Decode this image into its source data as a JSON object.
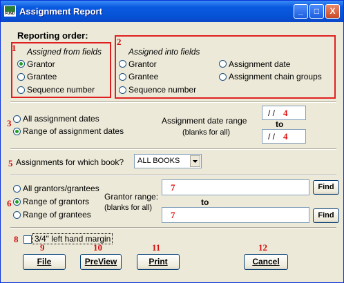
{
  "window": {
    "title": "Assignment Report",
    "app_icon_text": "FUND",
    "minimize": "_",
    "maximize": "□",
    "close": "X"
  },
  "reporting_order": {
    "header": "Reporting order:",
    "from_caption": "Assigned from fields",
    "from_options": [
      "Grantor",
      "Grantee",
      "Sequence number"
    ],
    "from_selected": "Grantor",
    "into_caption": "Assigned into fields",
    "into_options": [
      "Grantor",
      "Grantee",
      "Sequence number",
      "Assignment date",
      "Assignment chain groups"
    ]
  },
  "dates": {
    "options": [
      "All assignment dates",
      "Range of assignment dates"
    ],
    "selected": "Range of assignment dates",
    "range_label": "Assignment date range",
    "blanks_label": "(blanks for all)",
    "to_label": "to",
    "from_value": "/ /",
    "to_value": "/ /"
  },
  "book": {
    "label": "Assignments for which book?",
    "selected": "ALL BOOKS"
  },
  "grantors": {
    "options": [
      "All grantors/grantees",
      "Range of grantors",
      "Range of grantees"
    ],
    "selected": "Range of grantors",
    "range_label": "Grantor range:",
    "blanks_label": "(blanks for all)",
    "to_label": "to",
    "find_label": "Find"
  },
  "margin": {
    "label": "3/4\" left hand margin",
    "checked": false
  },
  "buttons": {
    "file": "File",
    "preview": "PreView",
    "print": "Print",
    "cancel": "Cancel"
  },
  "callouts": [
    "1",
    "2",
    "3",
    "4",
    "5",
    "6",
    "7",
    "8",
    "9",
    "10",
    "11",
    "12"
  ],
  "colors": {
    "titlebar": "#0a5ae0",
    "callout": "#e02020",
    "radio_dot": "#21a121"
  }
}
